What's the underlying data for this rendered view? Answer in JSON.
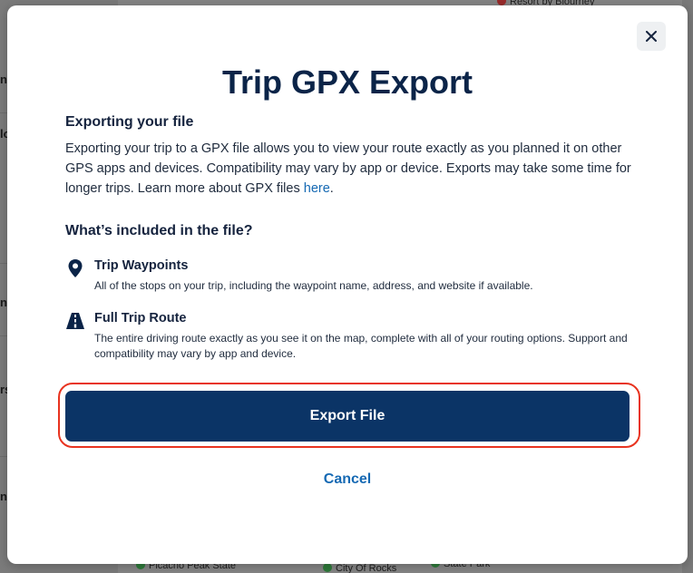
{
  "modal": {
    "title": "Trip GPX Export",
    "exporting_heading": "Exporting your file",
    "exporting_text": "Exporting your trip to a GPX file allows you to view your route exactly as you planned it on other GPS apps and devices. Compatibility may vary by app or device. Exports may take some time for longer trips. Learn more about GPX files ",
    "exporting_link": "here",
    "exporting_period": ".",
    "included_heading": "What’s included in the file?",
    "features": [
      {
        "icon": "map-pin-icon",
        "title": "Trip Waypoints",
        "description": "All of the stops on your trip, including the waypoint name, address, and website if available."
      },
      {
        "icon": "road-icon",
        "title": "Full Trip Route",
        "description": "The entire driving route exactly as you see it on the map, complete with all of your routing options. Support and compatibility may vary by app and device."
      }
    ],
    "export_button": "Export File",
    "cancel_button": "Cancel",
    "close_icon": "close-icon"
  },
  "background": {
    "map_labels": [
      "Resort by Blourney",
      "Picacho Peak State",
      "City Of Rocks",
      "State Park"
    ]
  },
  "colors": {
    "title": "#0b2448",
    "primary_button": "#0b3466",
    "link": "#1569b3",
    "highlight_ring": "#e8331f"
  }
}
